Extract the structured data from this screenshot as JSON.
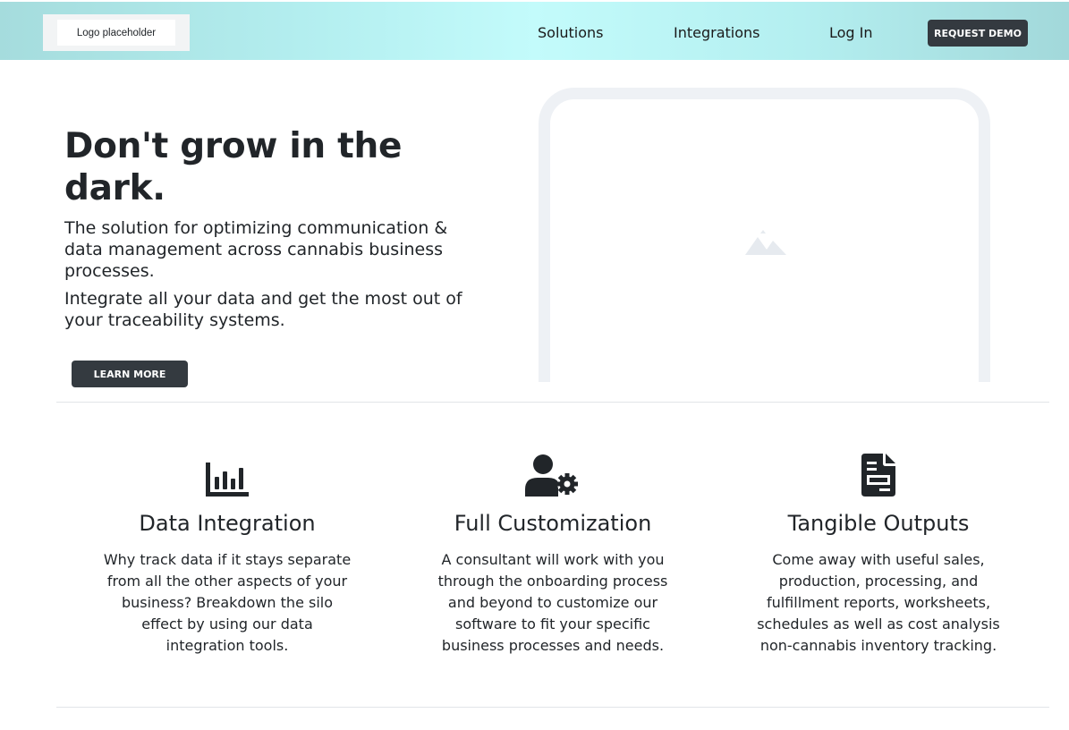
{
  "header": {
    "logo_text": "Logo placeholder",
    "nav": [
      "Solutions",
      "Integrations",
      "Log In"
    ],
    "cta_label": "REQUEST DEMO"
  },
  "hero": {
    "title": "Don't grow in the dark.",
    "paragraphs": [
      "The solution for optimizing communication & data management across cannabis business processes.",
      "Integrate all your data and get the most out of your traceability systems."
    ],
    "button_label": "LEARN MORE",
    "image_icon": "image-placeholder-icon"
  },
  "features": [
    {
      "icon": "bar-chart-icon",
      "title": "Data Integration",
      "text": "Why track data if it stays separate from all the other aspects of your business? Breakdown the silo effect by using our data integration tools."
    },
    {
      "icon": "user-cog-icon",
      "title": "Full Customization",
      "text": "A consultant will work with you through the onboarding process and beyond to customize our software to fit your specific business processes and needs."
    },
    {
      "icon": "document-icon",
      "title": "Tangible Outputs",
      "text": "Come away with useful sales, production, processing, and fulfillment reports, worksheets, schedules as well as cost analysis non-cannabis inventory tracking."
    }
  ],
  "colors": {
    "header_gradient_start": "#a5dcdd",
    "header_gradient_mid": "#c3fbfb",
    "button_dark": "#343a40",
    "text": "#212529"
  }
}
